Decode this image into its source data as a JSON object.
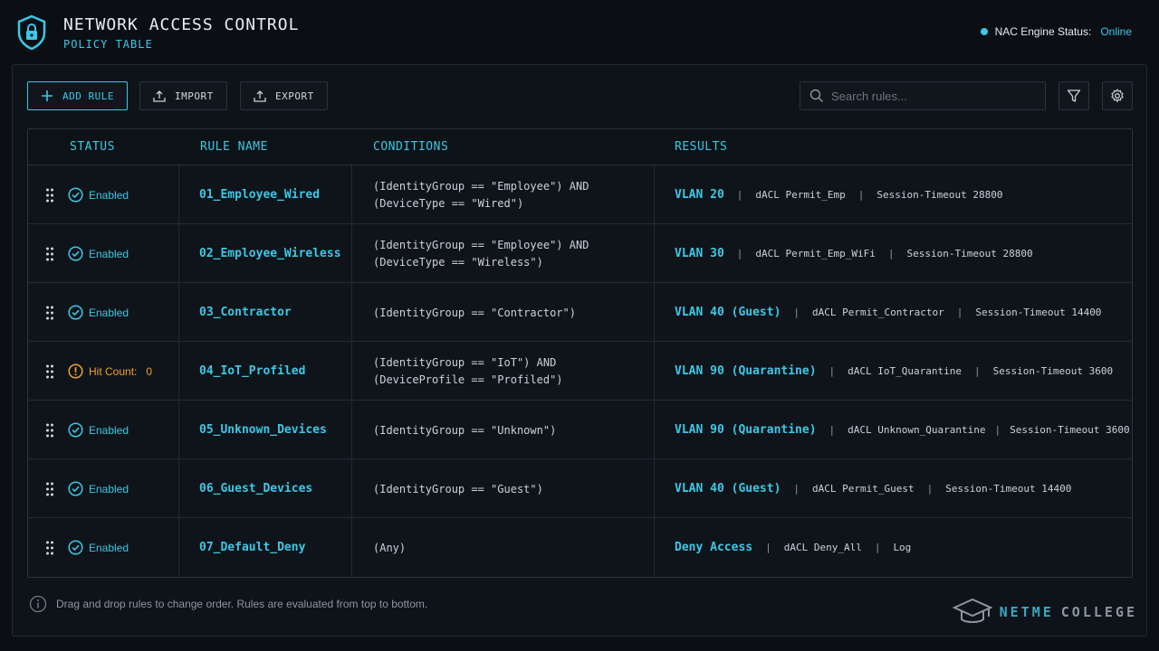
{
  "header": {
    "title": "NETWORK ACCESS CONTROL",
    "subtitle": "POLICY TABLE",
    "engine_status_label": "NAC Engine Status:",
    "engine_status_value": "Online"
  },
  "toolbar": {
    "add_rule": "ADD RULE",
    "import": "IMPORT",
    "export": "EXPORT",
    "search_placeholder": "Search rules..."
  },
  "table": {
    "columns": [
      "STATUS",
      "RULE NAME",
      "CONDITIONS",
      "RESULTS"
    ],
    "rows": [
      {
        "status": "Enabled",
        "name": "01_Employee_Wired",
        "conditions": [
          "(IdentityGroup == \"Employee\") AND",
          "(DeviceType == \"Wired\")"
        ],
        "vlan": "VLAN 20",
        "dacl": "dACL Permit_Emp",
        "extra": "Session-Timeout 28800"
      },
      {
        "status": "Enabled",
        "name": "02_Employee_Wireless",
        "conditions": [
          "(IdentityGroup == \"Employee\") AND",
          "(DeviceType == \"Wireless\")"
        ],
        "vlan": "VLAN 30",
        "dacl": "dACL Permit_Emp_WiFi",
        "extra": "Session-Timeout 28800"
      },
      {
        "status": "Enabled",
        "name": "03_Contractor",
        "conditions": [
          "(IdentityGroup == \"Contractor\")"
        ],
        "vlan": "VLAN 40 (Guest)",
        "dacl": "dACL Permit_Contractor",
        "extra": "Session-Timeout 14400"
      },
      {
        "status": "Hit Count:",
        "status_value": "0",
        "name": "04_IoT_Profiled",
        "conditions": [
          "(IdentityGroup == \"IoT\") AND",
          "(DeviceProfile == \"Profiled\")"
        ],
        "vlan": "VLAN 90 (Quarantine)",
        "dacl": "dACL IoT_Quarantine",
        "extra": "Session-Timeout 3600"
      },
      {
        "status": "Enabled",
        "name": "05_Unknown_Devices",
        "conditions": [
          "(IdentityGroup == \"Unknown\")"
        ],
        "vlan": "VLAN 90 (Quarantine)",
        "dacl": "dACL Unknown_Quarantine",
        "extra": "Session-Timeout 3600"
      },
      {
        "status": "Enabled",
        "name": "06_Guest_Devices",
        "conditions": [
          "(IdentityGroup == \"Guest\")"
        ],
        "vlan": "VLAN 40 (Guest)",
        "dacl": "dACL Permit_Guest",
        "extra": "Session-Timeout 14400"
      },
      {
        "status": "Enabled",
        "name": "07_Default_Deny",
        "conditions": [
          "(Any)"
        ],
        "vlan": "Deny Access",
        "dacl": "dACL Deny_All",
        "extra": "Log"
      }
    ]
  },
  "footer": {
    "note": "Drag and drop rules to change order. Rules are evaluated from top to bottom.",
    "brand_part1": "NETME",
    "brand_part2": "COLLEGE"
  },
  "colors": {
    "accent": "#3cc8e6",
    "warning": "#f0a030",
    "background": "#0b0f14"
  }
}
